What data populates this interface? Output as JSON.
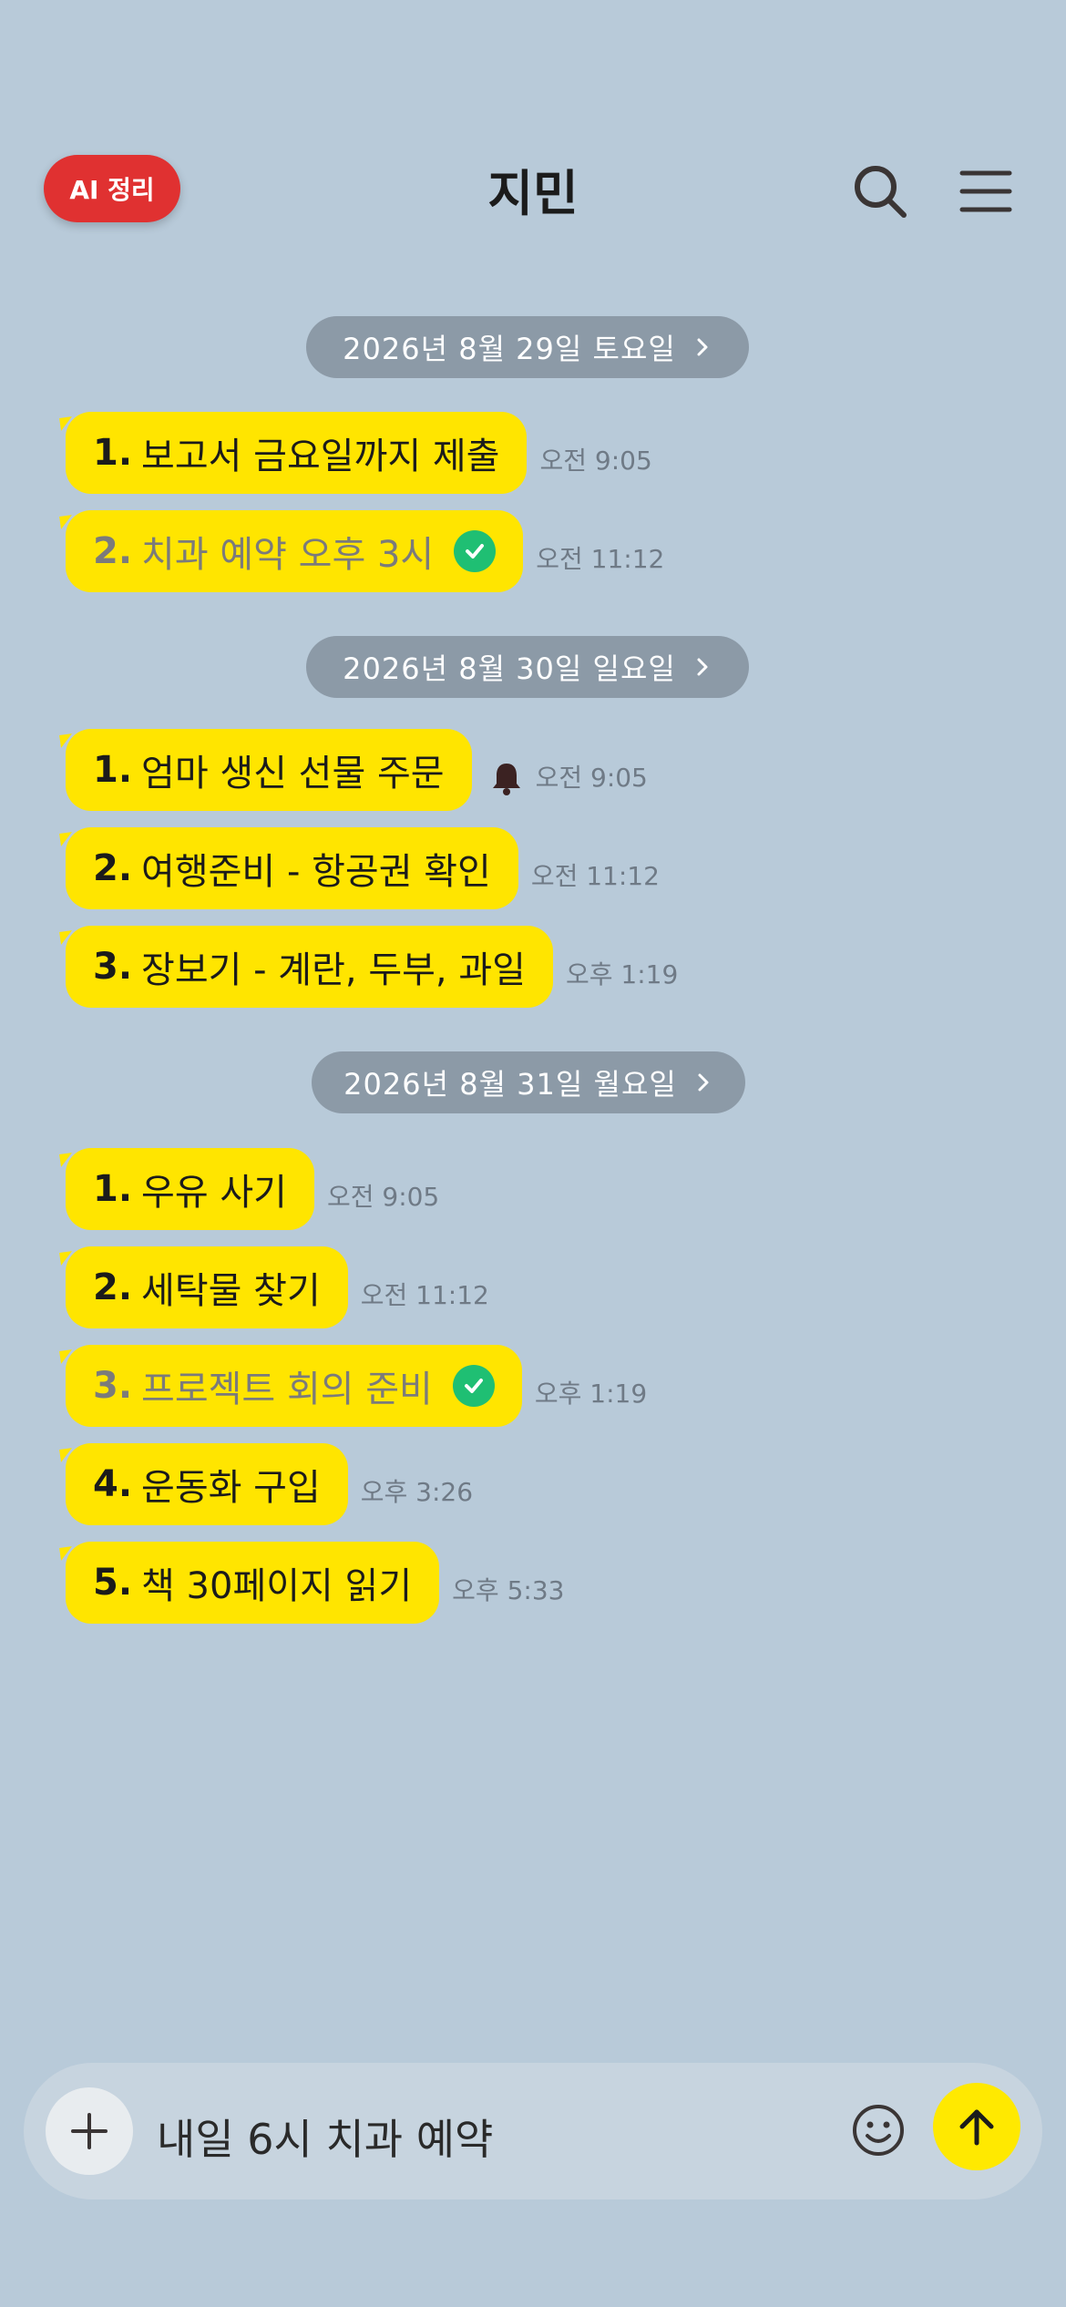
{
  "header": {
    "ai_button": "AI 정리",
    "title": "지민"
  },
  "groups": [
    {
      "date": "2026년 8월 29일 토요일",
      "items": [
        {
          "num": "1.",
          "text": "보고서 금요일까지 제출",
          "time": "오전 9:05",
          "done": false,
          "bell": false
        },
        {
          "num": "2.",
          "text": "치과 예약 오후 3시",
          "time": "오전 11:12",
          "done": true,
          "bell": false
        }
      ]
    },
    {
      "date": "2026년 8월 30일 일요일",
      "items": [
        {
          "num": "1.",
          "text": "엄마 생신 선물 주문",
          "time": "오전 9:05",
          "done": false,
          "bell": true
        },
        {
          "num": "2.",
          "text": "여행준비 - 항공권 확인",
          "time": "오전 11:12",
          "done": false,
          "bell": false
        },
        {
          "num": "3.",
          "text": "장보기 - 계란, 두부, 과일",
          "time": "오후 1:19",
          "done": false,
          "bell": false
        }
      ]
    },
    {
      "date": "2026년 8월 31일 월요일",
      "items": [
        {
          "num": "1.",
          "text": "우유 사기",
          "time": "오전 9:05",
          "done": false,
          "bell": false
        },
        {
          "num": "2.",
          "text": "세탁물 찾기",
          "time": "오전 11:12",
          "done": false,
          "bell": false
        },
        {
          "num": "3.",
          "text": "프로젝트 회의 준비",
          "time": "오후 1:19",
          "done": true,
          "bell": false
        },
        {
          "num": "4.",
          "text": "운동화 구입",
          "time": "오후 3:26",
          "done": false,
          "bell": false
        },
        {
          "num": "5.",
          "text": "책 30페이지 읽기",
          "time": "오후 5:33",
          "done": false,
          "bell": false
        }
      ]
    }
  ],
  "composer": {
    "input_value": "내일 6시 치과 예약"
  },
  "colors": {
    "background": "#b8cad9",
    "bubble": "#ffe500",
    "ai_button": "#e03131",
    "check": "#1fbf73",
    "send": "#ffe900",
    "date_pill": "#8c9aa7"
  }
}
